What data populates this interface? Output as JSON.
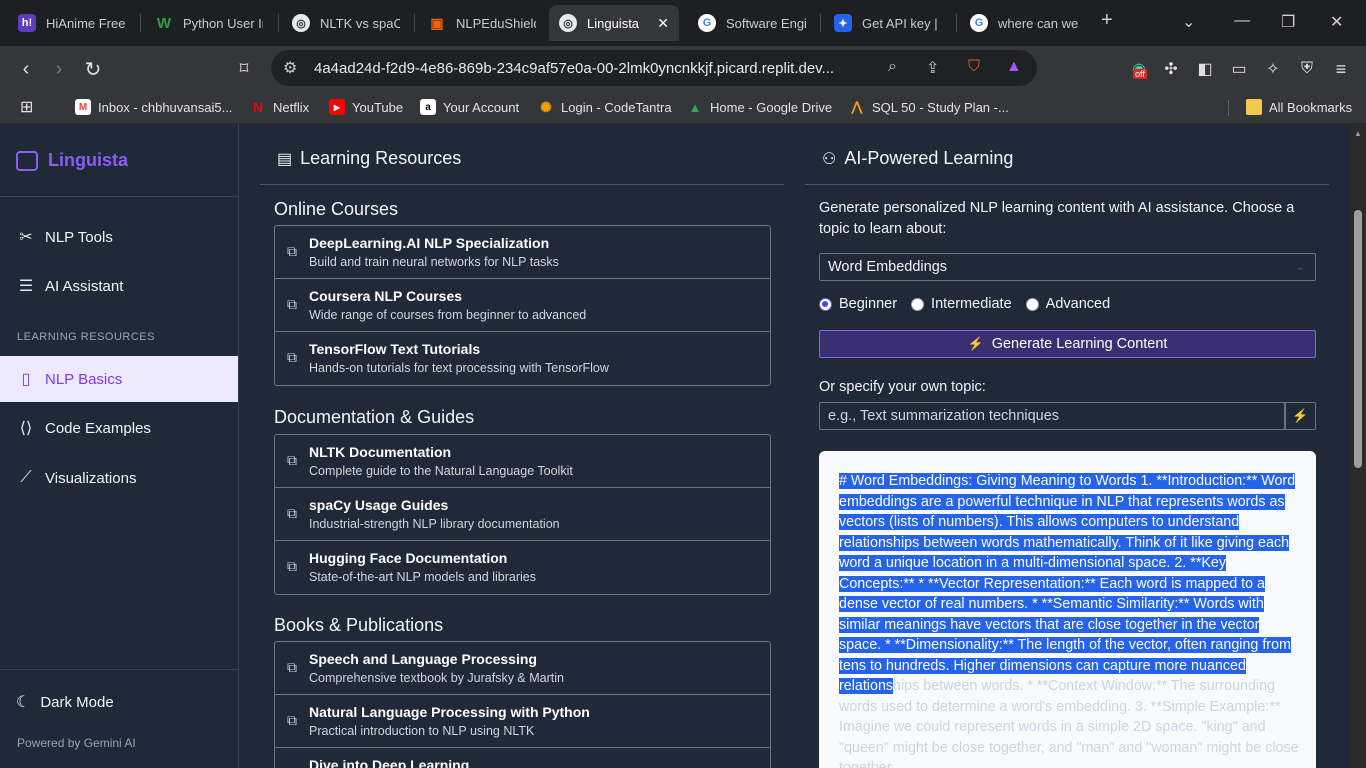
{
  "browser": {
    "tabs": [
      {
        "title": "HiAnime Free",
        "icon_text": "h!",
        "color": "#5b3fb8"
      },
      {
        "title": "Python User In",
        "icon_text": "W",
        "color": "#1a7a3a"
      },
      {
        "title": "NLTK vs spaCy",
        "icon_text": "◎",
        "color": "#444444"
      },
      {
        "title": "NLPEduShield",
        "icon_text": "▣",
        "color": "#f26207"
      },
      {
        "title": "Linguista",
        "icon_text": "◎",
        "color": "#444444"
      },
      {
        "title": "Software Engin",
        "icon_text": "G",
        "color": "#ffffff"
      },
      {
        "title": "Get API key | G",
        "icon_text": "✦",
        "color": "#2563eb"
      },
      {
        "title": "where can we",
        "icon_text": "G",
        "color": "#ffffff"
      }
    ],
    "url": "4a4ad24d-f2d9-4e86-869b-234c9af57e0a-00-2lmk0yncnkkjf.picard.replit.dev...",
    "bookmarks": [
      {
        "label": "Inbox - chbhuvansai5...",
        "icon": "M",
        "color": "#ea4335"
      },
      {
        "label": "Netflix",
        "icon": "N",
        "color": "#e50914"
      },
      {
        "label": "YouTube",
        "icon": "▶",
        "color": "#ff0000"
      },
      {
        "label": "Your Account",
        "icon": "a",
        "color": "#ffffff"
      },
      {
        "label": "Login - CodeTantra",
        "icon": "✺",
        "color": "#f59e0b"
      },
      {
        "label": "Home - Google Drive",
        "icon": "▲",
        "color": "#34a853"
      },
      {
        "label": "SQL 50 - Study Plan -...",
        "icon": "⋀",
        "color": "#f89f1b"
      }
    ],
    "all_bookmarks": "All Bookmarks",
    "ext_badge": "off"
  },
  "sidebar": {
    "brand": "Linguista",
    "items": [
      {
        "label": "NLP Tools",
        "icon": "tools-icon"
      },
      {
        "label": "AI Assistant",
        "icon": "chat-icon"
      }
    ],
    "section_label": "LEARNING RESOURCES",
    "section_items": [
      {
        "label": "NLP Basics",
        "icon": "book-icon",
        "active": true
      },
      {
        "label": "Code Examples",
        "icon": "code-icon"
      },
      {
        "label": "Visualizations",
        "icon": "chart-line-icon"
      }
    ],
    "dark_mode": "Dark Mode",
    "powered_by": "Powered by Gemini AI"
  },
  "learning": {
    "title": "Learning Resources",
    "groups": [
      {
        "heading": "Online Courses",
        "items": [
          {
            "title": "DeepLearning.AI NLP Specialization",
            "desc": "Build and train neural networks for NLP tasks"
          },
          {
            "title": "Coursera NLP Courses",
            "desc": "Wide range of courses from beginner to advanced"
          },
          {
            "title": "TensorFlow Text Tutorials",
            "desc": "Hands-on tutorials for text processing with TensorFlow"
          }
        ]
      },
      {
        "heading": "Documentation & Guides",
        "items": [
          {
            "title": "NLTK Documentation",
            "desc": "Complete guide to the Natural Language Toolkit"
          },
          {
            "title": "spaCy Usage Guides",
            "desc": "Industrial-strength NLP library documentation"
          },
          {
            "title": "Hugging Face Documentation",
            "desc": "State-of-the-art NLP models and libraries"
          }
        ]
      },
      {
        "heading": "Books & Publications",
        "items": [
          {
            "title": "Speech and Language Processing",
            "desc": "Comprehensive textbook by Jurafsky & Martin"
          },
          {
            "title": "Natural Language Processing with Python",
            "desc": "Practical introduction to NLP using NLTK"
          },
          {
            "title": "Dive into Deep Learning",
            "desc": ""
          }
        ]
      }
    ]
  },
  "ai": {
    "title": "AI-Powered Learning",
    "description": "Generate personalized NLP learning content with AI assistance. Choose a topic to learn about:",
    "topic_selected": "Word Embeddings",
    "levels": [
      {
        "label": "Beginner",
        "checked": true
      },
      {
        "label": "Intermediate",
        "checked": false
      },
      {
        "label": "Advanced",
        "checked": false
      }
    ],
    "generate_label": "Generate Learning Content",
    "own_topic_label": "Or specify your own topic:",
    "own_topic_placeholder": "e.g., Text summarization techniques",
    "content_selected": "# Word Embeddings: Giving Meaning to Words 1. **Introduction:** Word embeddings are a powerful technique in NLP that represents words as vectors (lists of numbers). This allows computers to understand relationships between words mathematically. Think of it like giving each word a unique location in a multi-dimensional space. 2. **Key Concepts:** * **Vector Representation:** Each word is mapped to a dense vector of real numbers. * **Semantic Similarity:** Words with similar meanings have vectors that are close together in the vector space. * **Dimensionality:** The length of the vector, often ranging from tens to hundreds. Higher dimensions can capture more nuanced relations",
    "content_rest": "hips between words. * **Context Window:** The surrounding words used to determine a word's embedding. 3. **Simple Example:** Imagine we could represent words in a simple 2D space. \"king\" and \"queen\" might be close together, and \"man\" and \"woman\" might be close together."
  }
}
